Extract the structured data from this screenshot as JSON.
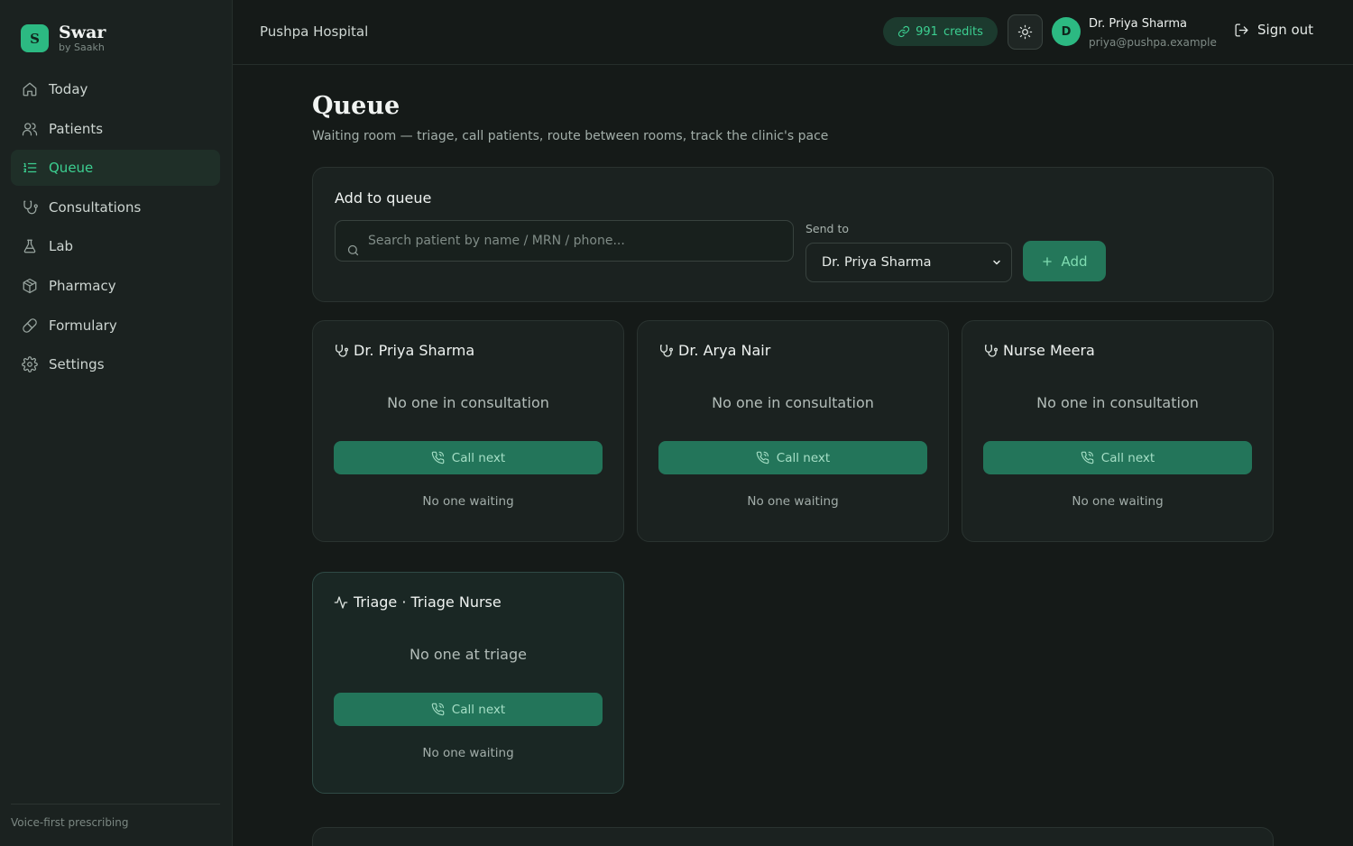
{
  "brand": {
    "logo_letter": "S",
    "name": "Swar",
    "sub": "by Saakh"
  },
  "sidebar": {
    "items": [
      {
        "label": "Today",
        "icon": "home-icon",
        "active": false
      },
      {
        "label": "Patients",
        "icon": "users-icon",
        "active": false
      },
      {
        "label": "Queue",
        "icon": "list-ordered-icon",
        "active": true
      },
      {
        "label": "Consultations",
        "icon": "stethoscope-icon",
        "active": false
      },
      {
        "label": "Lab",
        "icon": "flask-icon",
        "active": false
      },
      {
        "label": "Pharmacy",
        "icon": "package-icon",
        "active": false
      },
      {
        "label": "Formulary",
        "icon": "pill-icon",
        "active": false
      },
      {
        "label": "Settings",
        "icon": "gear-icon",
        "active": false
      }
    ],
    "footer": "Voice-first prescribing"
  },
  "header": {
    "hospital": "Pushpa Hospital",
    "credits_value": "991",
    "credits_label": "credits",
    "avatar_letter": "D",
    "user_name": "Dr. Priya Sharma",
    "user_email": "priya@pushpa.example",
    "signout_label": "Sign out"
  },
  "page": {
    "title": "Queue",
    "subtitle": "Waiting room — triage, call patients, route between rooms, track the clinic's pace"
  },
  "add_queue": {
    "title": "Add to queue",
    "search_placeholder": "Search patient by name / MRN / phone...",
    "send_to_label": "Send to",
    "send_to_value": "Dr. Priya Sharma",
    "add_label": "Add"
  },
  "rooms": [
    {
      "name": "Dr. Priya Sharma",
      "icon": "stethoscope-icon",
      "state": "No one in consultation",
      "call_label": "Call next",
      "waiting": "No one waiting"
    },
    {
      "name": "Dr. Arya Nair",
      "icon": "stethoscope-icon",
      "state": "No one in consultation",
      "call_label": "Call next",
      "waiting": "No one waiting"
    },
    {
      "name": "Nurse Meera",
      "icon": "stethoscope-icon",
      "state": "No one in consultation",
      "call_label": "Call next",
      "waiting": "No one waiting"
    },
    {
      "name": "Triage · Triage Nurse",
      "icon": "activity-icon",
      "state": "No one at triage",
      "call_label": "Call next",
      "waiting": "No one waiting"
    }
  ],
  "colors": {
    "accent": "#3ccf91",
    "button_green": "#23755a",
    "background": "#151a18",
    "sidebar": "#1b2220"
  }
}
